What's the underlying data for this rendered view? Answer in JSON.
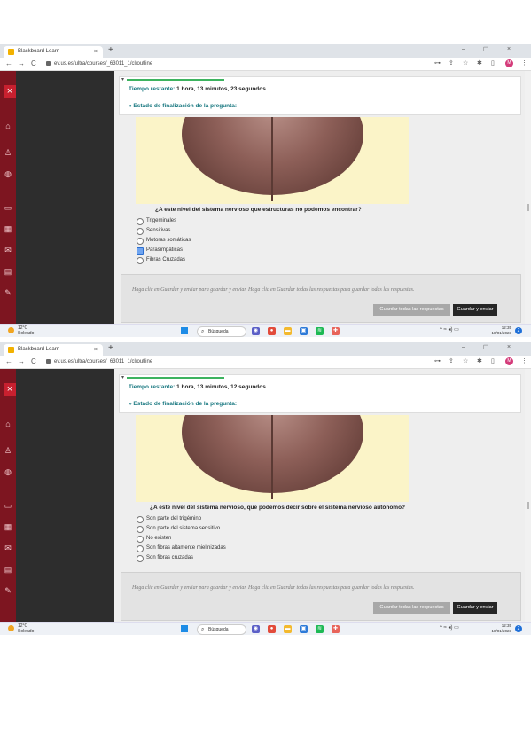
{
  "browser": {
    "tab_title": "Blackboard Learn",
    "tab_close": "×",
    "new_tab": "+",
    "url": "ev.us.es/ultra/courses/_63011_1/cl/outline",
    "minimize": "–",
    "restore": "☐",
    "close": "×",
    "profile_initial": "M"
  },
  "nav_icons": {
    "back": "←",
    "forward": "→",
    "reload": "C"
  },
  "toolbar_icons": {
    "key": "⊶",
    "share": "⇪",
    "star": "☆",
    "extensions": "✱",
    "sidebar": "▯",
    "menu": "⋮"
  },
  "sidebar": {
    "close_glyph": "×",
    "icons": [
      "institution-icon",
      "user-icon",
      "globe-icon",
      "courses-icon",
      "calendar-icon",
      "mail-icon",
      "grades-icon",
      "tools-icon"
    ],
    "glyphs": {
      "institution": "⌂",
      "user": "♙",
      "globe": "◍",
      "courses": "▭",
      "calendar": "▦",
      "mail": "✉",
      "grades": "▤",
      "tools": "✎"
    }
  },
  "shots": [
    {
      "timer_label": "Tiempo restante:",
      "timer_value": "1 hora, 13 minutos, 23 segundos.",
      "status_label": "» Estado de finalización de la pregunta:",
      "question": "¿A este nivel del sistema nervioso que estructuras no podemos encontrar?",
      "options": [
        "Trigeminales",
        "Sensitivas",
        "Motoras somáticas",
        "Parasimpáticas",
        "Fibras Cruzadas"
      ],
      "selected": 3,
      "footer_note": "Haga clic en Guardar y enviar para guardar y enviar. Haga clic en Guardar todas las respuestas para guardar todas las respuestas.",
      "save_all": "Guardar todas las respuestas",
      "save_submit": "Guardar y enviar",
      "temperature": "12°C",
      "weather": "Soleado",
      "search": "Búsqueda",
      "time": "12:35",
      "date": "18/01/2023",
      "notifications": "2"
    },
    {
      "timer_label": "Tiempo restante:",
      "timer_value": "1 hora, 13 minutos, 12 segundos.",
      "status_label": "» Estado de finalización de la pregunta:",
      "question": "¿A este nivel del sistema nervioso, que podemos decir sobre el sistema nervioso autónomo?",
      "options": [
        "Son parte del trigémino",
        "Son parte del sistema sensitivo",
        "No existen",
        "Son fibras altamente mielinizadas",
        "Son fibras cruzadas"
      ],
      "selected": -1,
      "footer_note": "Haga clic en Guardar y enviar para guardar y enviar. Haga clic en Guardar todas las respuestas para guardar todas las respuestas.",
      "save_all": "Guardar todas las respuestas",
      "save_submit": "Guardar y enviar",
      "temperature": "12°C",
      "weather": "Soleado",
      "search": "Búsqueda",
      "time": "12:35",
      "date": "18/01/2023",
      "notifications": "2"
    }
  ],
  "taskbar_icons": [
    {
      "name": "chat-icon",
      "color": "#5b5fc7",
      "glyph": "◉"
    },
    {
      "name": "chrome-icon",
      "color": "#e24b3b",
      "glyph": "●"
    },
    {
      "name": "folder-icon",
      "color": "#f3b92e",
      "glyph": "▬"
    },
    {
      "name": "store-icon",
      "color": "#2d7ad8",
      "glyph": "▣"
    },
    {
      "name": "spotify-icon",
      "color": "#1db954",
      "glyph": "≋"
    },
    {
      "name": "app-icon",
      "color": "#e8645a",
      "glyph": "✚"
    }
  ],
  "tray_glyphs": "^  ≈  ◂)  ▭",
  "colors": {
    "accent": "#197880",
    "sidebar_red": "#7d1520",
    "selected": "#6fa4f0"
  }
}
